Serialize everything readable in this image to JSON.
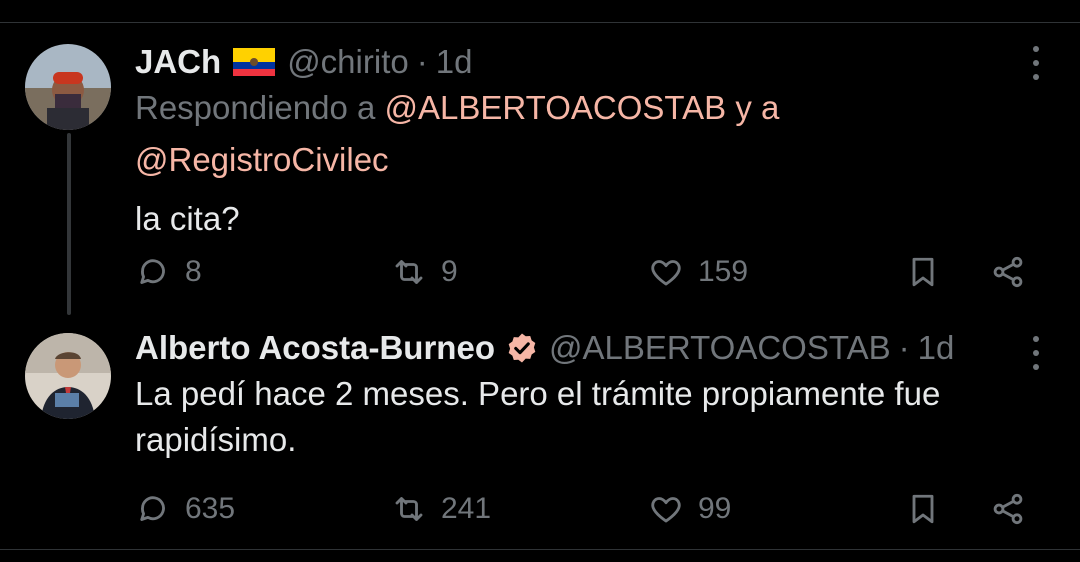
{
  "tweets": [
    {
      "name": "JACh",
      "flag_icon": "ecuador-flag-icon",
      "handle": "@chirito",
      "separator": "·",
      "time": "1d",
      "reply_prefix": "Respondiendo a",
      "reply_mention_1": "@ALBERTOACOSTAB",
      "reply_connector": "y a",
      "reply_mention_2": "@RegistroCivilec",
      "text": "la cita?",
      "replies": "8",
      "retweets": "9",
      "likes": "159"
    },
    {
      "name": "Alberto Acosta-Burneo",
      "verified_icon": "verified-badge-icon",
      "handle": "@ALBERTOACOSTAB",
      "separator": "·",
      "time": "1d",
      "text_line_1": "La pedí hace 2 meses. Pero el trámite propiamente fue",
      "text_line_2": "rapidísimo.",
      "replies": "635",
      "retweets": "241",
      "likes": "99"
    }
  ],
  "colors": {
    "background": "#000000",
    "text": "#e7e9ea",
    "muted": "#71767b",
    "mention": "#f6b6a6",
    "verified": "#f6b6a6",
    "divider": "#2f3336"
  }
}
